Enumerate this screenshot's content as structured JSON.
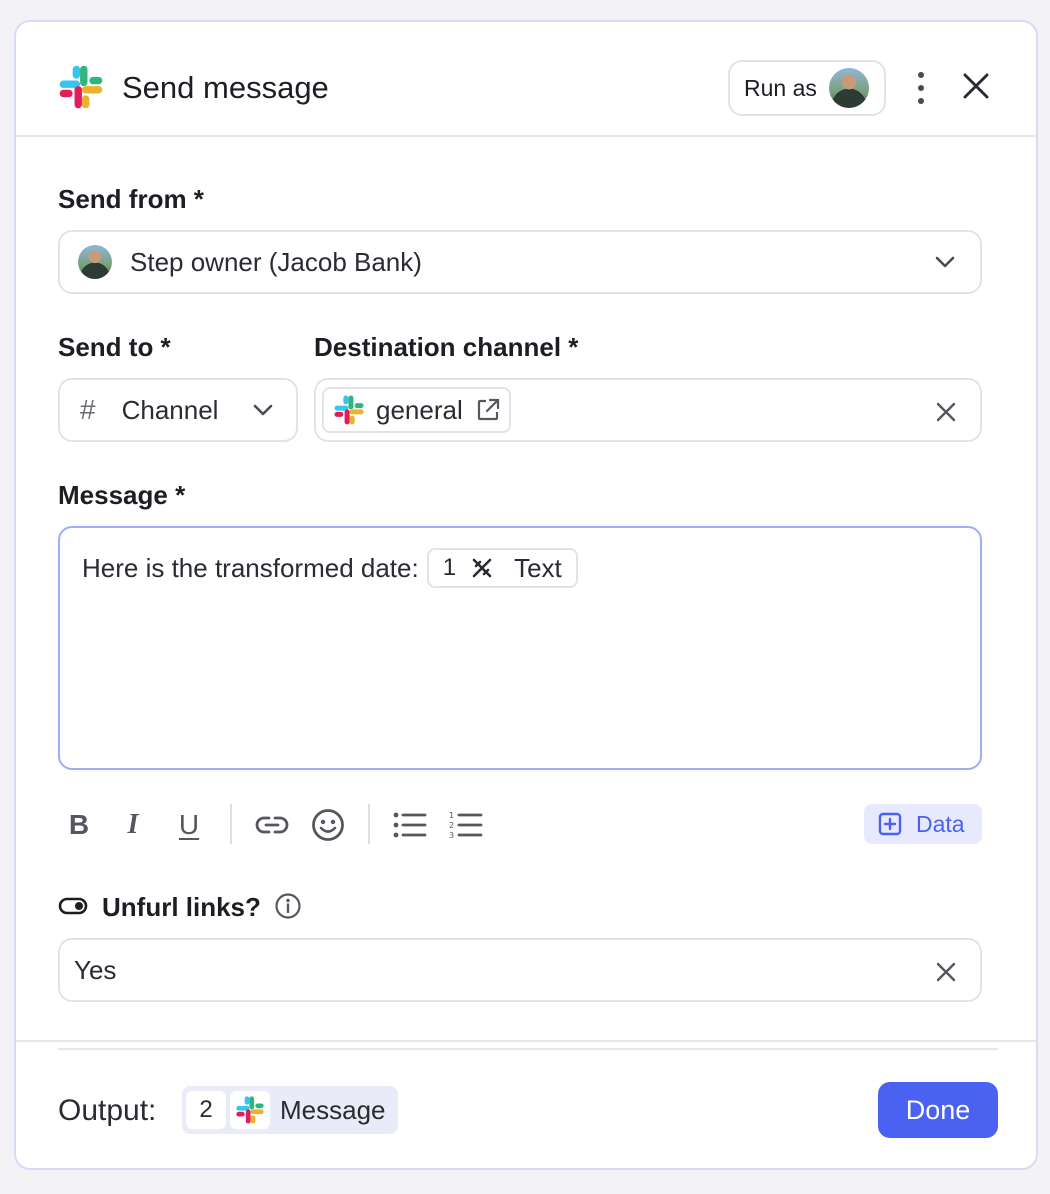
{
  "header": {
    "title": "Send message",
    "run_as_label": "Run as"
  },
  "send_from": {
    "label": "Send from *",
    "value": "Step owner (Jacob Bank)"
  },
  "send_to": {
    "label": "Send to *",
    "value": "Channel",
    "icon": "#"
  },
  "destination": {
    "label": "Destination channel *",
    "channel_name": "general"
  },
  "message": {
    "label": "Message *",
    "text": "Here is the transformed date:",
    "token_step": "1",
    "token_label": "Text"
  },
  "toolbar": {
    "bold": "B",
    "italic": "I",
    "underline": "U",
    "data_label": "Data"
  },
  "unfurl": {
    "label": "Unfurl links?",
    "value": "Yes"
  },
  "footer": {
    "output_label": "Output:",
    "output_step": "2",
    "output_name": "Message",
    "done_label": "Done"
  },
  "colors": {
    "accent": "#4a61f1",
    "data_bg": "#e7eafd",
    "editor_border": "#9eaef4",
    "slack_blue": "#36c5f0",
    "slack_green": "#2eb67d",
    "slack_red": "#e01e5a",
    "slack_yellow": "#ecb22e"
  }
}
